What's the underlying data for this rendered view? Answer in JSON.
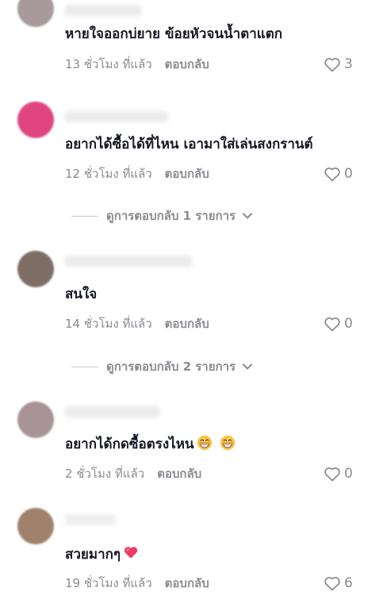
{
  "comments": [
    {
      "text": "หายใจออกบ่ยาย ข้อยหัวจนน้ำตาแตก",
      "time": "13 ชั่วโมง ที่แล้ว",
      "reply_label": "ตอบกลับ",
      "likes": "3",
      "avatar_color": "#a89a9c"
    },
    {
      "text": "อยากได้ซื้อได้ที่ไหน เอามาใส่เล่นสงกรานต์",
      "time": "12 ชั่วโมง ที่แล้ว",
      "reply_label": "ตอบกลับ",
      "likes": "0",
      "avatar_color": "#e0457f",
      "view_replies": "ดูการตอบกลับ 1 รายการ"
    },
    {
      "text": "สนใจ",
      "time": "14 ชั่วโมง ที่แล้ว",
      "reply_label": "ตอบกลับ",
      "likes": "0",
      "avatar_color": "#7d6e66",
      "view_replies": "ดูการตอบกลับ 2 รายการ"
    },
    {
      "text": "อยากได้กดซื้อตรงไหน",
      "emoji": "grinning-face-emoji",
      "time": "2 ชั่วโมง ที่แล้ว",
      "reply_label": "ตอบกลับ",
      "likes": "0",
      "avatar_color": "#a89497"
    },
    {
      "text": "สวยมากๆ",
      "emoji": "heart-emoji",
      "time": "19 ชั่วโมง ที่แล้ว",
      "reply_label": "ตอบกลับ",
      "likes": "6",
      "avatar_color": "#a0826c"
    }
  ],
  "colors": {
    "text": "#161823",
    "meta": "#8a8b91",
    "heart_emoji": "#ef3b64"
  }
}
